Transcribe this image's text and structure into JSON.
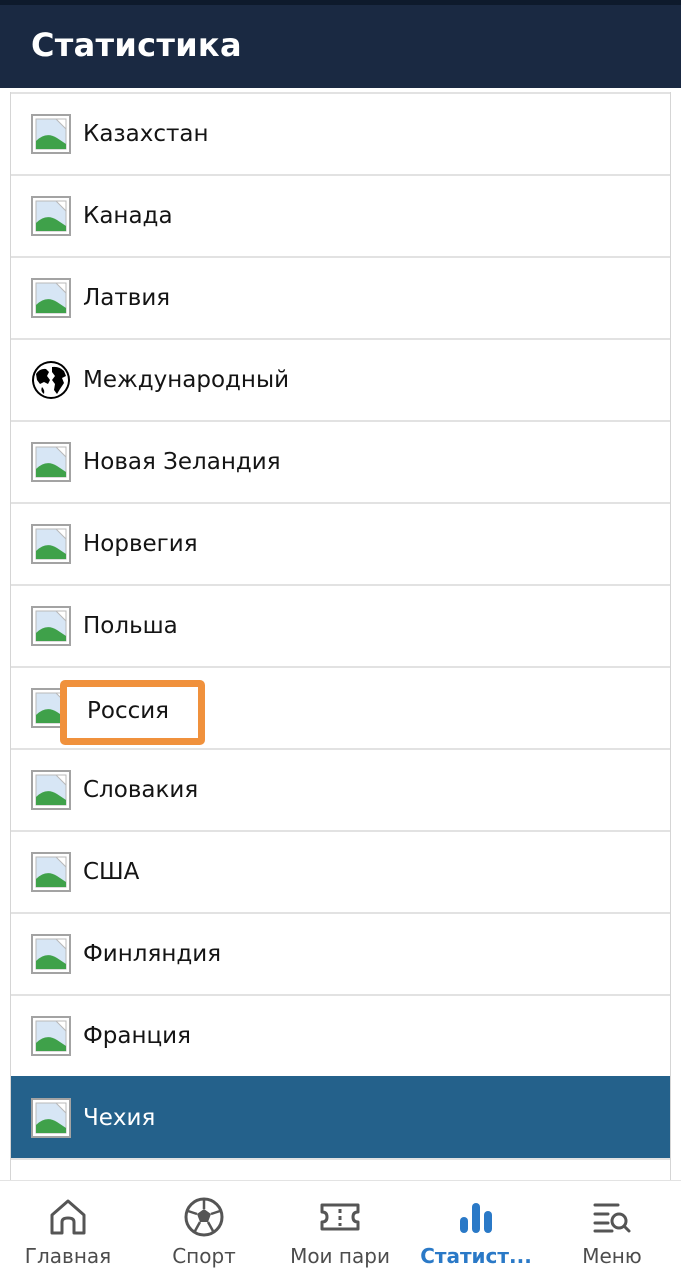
{
  "header": {
    "title": "Статистика"
  },
  "list": {
    "items": [
      {
        "label": "Казахстан",
        "icon": "broken-image-icon"
      },
      {
        "label": "Канада",
        "icon": "broken-image-icon"
      },
      {
        "label": "Латвия",
        "icon": "broken-image-icon"
      },
      {
        "label": "Международный",
        "icon": "globe-icon"
      },
      {
        "label": "Новая Зеландия",
        "icon": "broken-image-icon"
      },
      {
        "label": "Норвегия",
        "icon": "broken-image-icon"
      },
      {
        "label": "Польша",
        "icon": "broken-image-icon"
      },
      {
        "label": "Россия",
        "icon": "broken-image-icon"
      },
      {
        "label": "Словакия",
        "icon": "broken-image-icon"
      },
      {
        "label": "США",
        "icon": "broken-image-icon"
      },
      {
        "label": "Финляндия",
        "icon": "broken-image-icon"
      },
      {
        "label": "Франция",
        "icon": "broken-image-icon"
      },
      {
        "label": "Чехия",
        "icon": "broken-image-icon",
        "selected": true
      }
    ]
  },
  "bottom_nav": {
    "items": [
      {
        "label": "Главная",
        "icon": "home-icon"
      },
      {
        "label": "Спорт",
        "icon": "soccer-ball-icon"
      },
      {
        "label": "Мои пари",
        "icon": "ticket-icon"
      },
      {
        "label": "Статист...",
        "icon": "bar-chart-icon",
        "active": true
      },
      {
        "label": "Меню",
        "icon": "menu-search-icon"
      }
    ]
  },
  "colors": {
    "header_bg": "#1a2942",
    "selected_row_bg": "#24618b",
    "active_nav": "#2a79c7",
    "highlight_border": "#f0913c"
  }
}
